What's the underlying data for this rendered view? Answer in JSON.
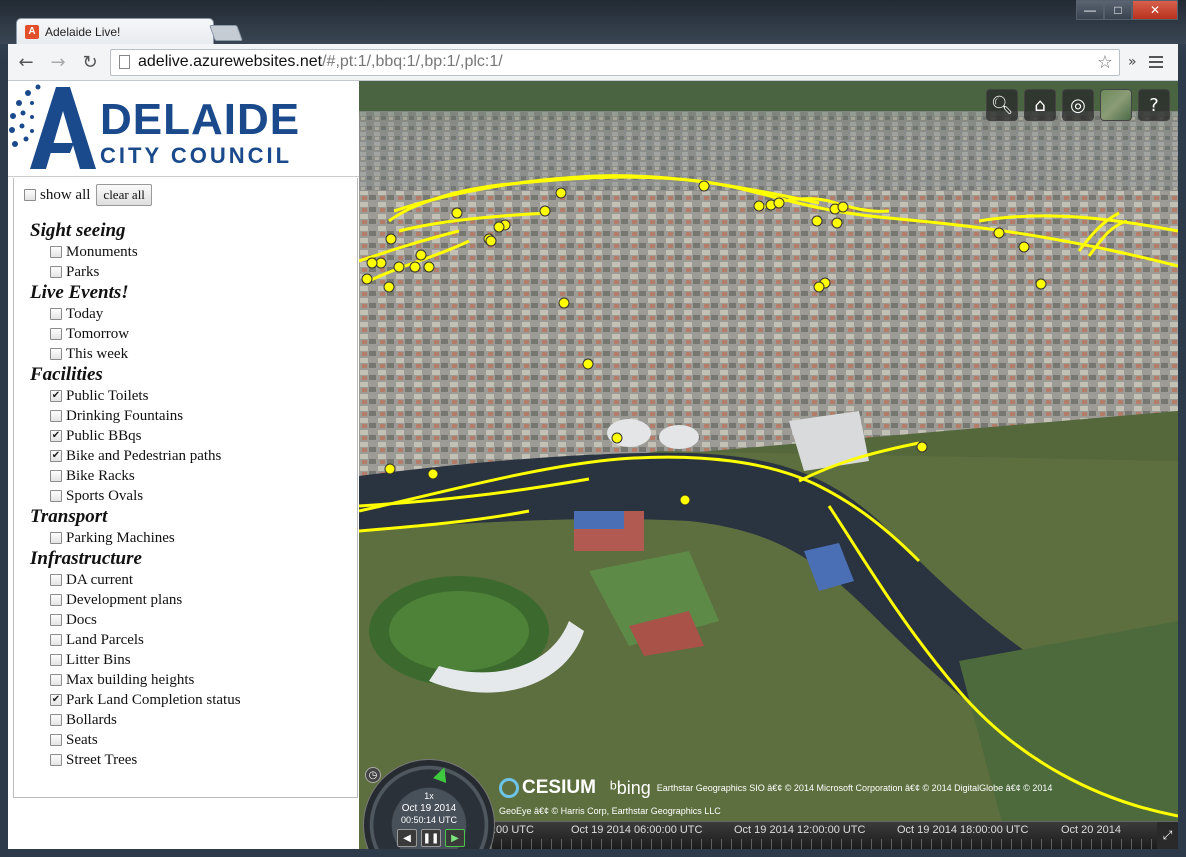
{
  "browser": {
    "tab_title": "Adelaide Live!",
    "url_host": "adelive.azurewebsites.net",
    "url_path": "/#,pt:1/,bbq:1/,bp:1/,plc:1/"
  },
  "logo": {
    "line1": "DELAIDE",
    "line2": "CITY COUNCIL",
    "accent_color": "#1a4a8c"
  },
  "controls": {
    "show_all_label": "show all",
    "show_all_checked": false,
    "clear_all_label": "clear all"
  },
  "groups": [
    {
      "title": "Sight seeing",
      "items": [
        {
          "label": "Monuments",
          "checked": false
        },
        {
          "label": "Parks",
          "checked": false
        }
      ]
    },
    {
      "title": "Live Events!",
      "items": [
        {
          "label": "Today",
          "checked": false
        },
        {
          "label": "Tomorrow",
          "checked": false
        },
        {
          "label": "This week",
          "checked": false
        }
      ]
    },
    {
      "title": "Facilities",
      "items": [
        {
          "label": "Public Toilets",
          "checked": true
        },
        {
          "label": "Drinking Fountains",
          "checked": false
        },
        {
          "label": "Public BBqs",
          "checked": true
        },
        {
          "label": "Bike and Pedestrian paths",
          "checked": true
        },
        {
          "label": "Bike Racks",
          "checked": false
        },
        {
          "label": "Sports Ovals",
          "checked": false
        }
      ]
    },
    {
      "title": "Transport",
      "items": [
        {
          "label": "Parking Machines",
          "checked": false
        }
      ]
    },
    {
      "title": "Infrastructure",
      "items": [
        {
          "label": "DA current",
          "checked": false
        },
        {
          "label": "Development plans",
          "checked": false
        },
        {
          "label": "Docs",
          "checked": false
        },
        {
          "label": "Land Parcels",
          "checked": false
        },
        {
          "label": "Litter Bins",
          "checked": false
        },
        {
          "label": "Max building heights",
          "checked": false
        },
        {
          "label": "Park Land Completion status",
          "checked": true
        },
        {
          "label": "Bollards",
          "checked": false
        },
        {
          "label": "Seats",
          "checked": false
        },
        {
          "label": "Street Trees",
          "checked": false
        }
      ]
    }
  ],
  "map": {
    "tools": [
      "search-icon",
      "home-icon",
      "globe-icon",
      "imagery-picker-icon",
      "help-icon"
    ],
    "help_glyph": "?",
    "credits": {
      "cesium": "CESIUM",
      "bing": "bing",
      "line1": "Earthstar Geographics SIO â€¢ © 2014 Microsoft Corporation â€¢ © 2014 DigitalGlobe â€¢ © 2014",
      "line2": "GeoEye â€¢ © Harris Corp, Earthstar Geographics LLC"
    },
    "overlay_color": "#ffff00",
    "clock": {
      "speed": "1x",
      "date": "Oct 19 2014",
      "time": "00:50:14 UTC"
    },
    "timeline_labels": [
      ":00 UTC",
      "Oct 19 2014 06:00:00 UTC",
      "Oct 19 2014 12:00:00 UTC",
      "Oct 19 2014 18:00:00 UTC",
      "Oct 20 2014"
    ]
  }
}
